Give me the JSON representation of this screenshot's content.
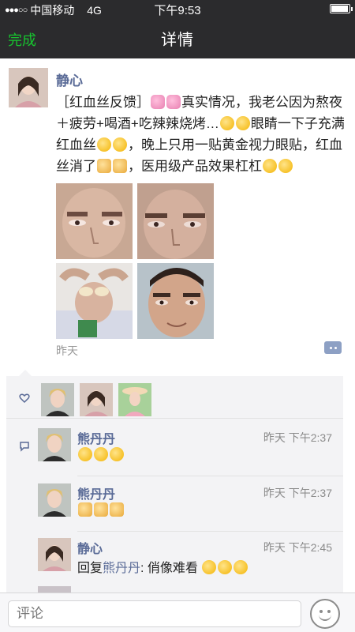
{
  "status_bar": {
    "carrier": "中国移动",
    "network": "4G",
    "time": "下午9:53",
    "battery_level": 0.95
  },
  "nav": {
    "back_label": "完成",
    "title": "详情"
  },
  "post": {
    "author": "静心",
    "text_parts": {
      "p1": "［红血丝反馈］",
      "p2": "真实情况，我老公因为熬夜＋疲劳+喝酒+吃辣辣烧烤…",
      "p3": "眼睛一下子充满红血丝",
      "p4": "，晚上只用一贴黄金视力眼贴，红血丝消了",
      "p5": "，医用级产品效果杠杠"
    },
    "photos": [
      "photo-1",
      "photo-2",
      "photo-3",
      "photo-4"
    ],
    "time": "昨天"
  },
  "comments": [
    {
      "name": "熊丹丹",
      "time": "昨天 下午2:37",
      "text": ""
    },
    {
      "name": "熊丹丹",
      "time": "昨天 下午2:37",
      "text": ""
    },
    {
      "name": "静心",
      "time": "昨天 下午2:45",
      "reply_prefix": "回复",
      "reply_to": "熊丹丹",
      "text": ": 俏像难看"
    }
  ],
  "input": {
    "placeholder": "评论"
  },
  "colors": {
    "link_blue": "#5a6b97",
    "nav_bg": "#2b2b2d",
    "accent_green": "#17c42f"
  }
}
